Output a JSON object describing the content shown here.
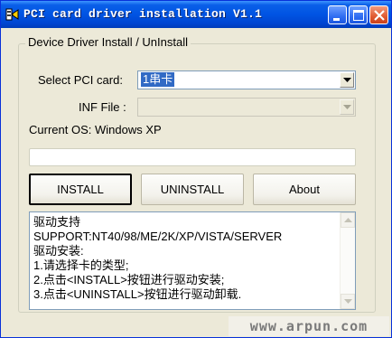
{
  "window": {
    "title": "PCI card driver installation V1.1",
    "colors": {
      "titlebar": "#0054e3",
      "face": "#ece9d8",
      "selection": "#316ac5",
      "close_button": "#e05a31"
    }
  },
  "titlebar_buttons": {
    "minimize_icon": "minimize-icon",
    "maximize_icon": "maximize-icon",
    "close_icon": "close-icon"
  },
  "group": {
    "title": "Device Driver Install / UnInstall"
  },
  "select_pci_card": {
    "label": "Select PCI card:",
    "value": "1串卡"
  },
  "inf_file": {
    "label": "INF File :",
    "value": ""
  },
  "current_os": {
    "text": "Current OS: Windows XP"
  },
  "progress": {
    "percent": 0
  },
  "buttons": {
    "install": "INSTALL",
    "uninstall": "UNINSTALL",
    "about": "About"
  },
  "memo": {
    "lines": [
      "驱动支持",
      "SUPPORT:NT40/98/ME/2K/XP/VISTA/SERVER",
      "驱动安装:",
      "1.请选择卡的类型;",
      "2.点击<INSTALL>按钮进行驱动安装;",
      "3.点击<UNINSTALL>按钮进行驱动卸载."
    ]
  },
  "watermark": "www.arpun.com"
}
